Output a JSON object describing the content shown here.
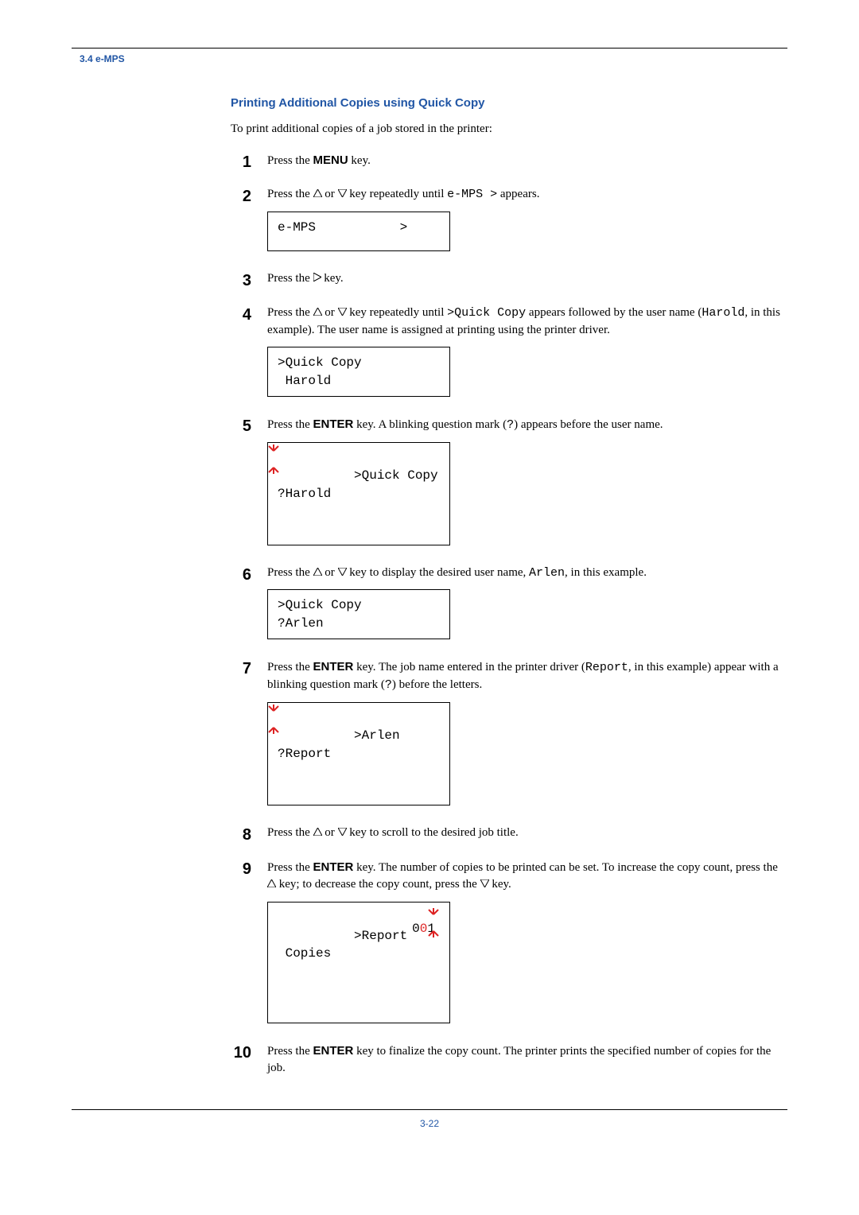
{
  "header": {
    "section": "3.4 e-MPS"
  },
  "title": "Printing Additional Copies using Quick Copy",
  "intro": "To print additional copies of a job stored in the printer:",
  "steps": {
    "s1": {
      "n": "1",
      "pre": "Press the ",
      "bold": "MENU",
      "post": " key."
    },
    "s2": {
      "n": "2",
      "a": "Press the  ",
      "b": " or ",
      "c": " key repeatedly until ",
      "mono": "e-MPS >",
      "d": " appears."
    },
    "s2d": "e-MPS           >\n",
    "s3": {
      "n": "3",
      "a": "Press the ",
      "b": " key."
    },
    "s4": {
      "n": "4",
      "a": "Press the ",
      "b": " or ",
      "c": " key repeatedly until ",
      "mono1": ">Quick Copy",
      "d": " appears followed by the user name (",
      "mono2": "Harold",
      "e": ", in this example). The user name is assigned at printing using the printer driver."
    },
    "s4d": ">Quick Copy\n Harold",
    "s5": {
      "n": "5",
      "a": "Press the ",
      "bold": "ENTER",
      "b": " key. A blinking question mark (",
      "mono": "?",
      "c": ") appears before the user name."
    },
    "s5d": ">Quick Copy\n?Harold",
    "s6": {
      "n": "6",
      "a": "Press the ",
      "b": " or ",
      "c": " key to display the desired user name, ",
      "mono": "Arlen",
      "d": ", in this example."
    },
    "s6d": ">Quick Copy\n?Arlen",
    "s7": {
      "n": "7",
      "a": "Press the ",
      "bold": "ENTER",
      "b": " key. The job name entered in the printer driver (",
      "mono1": "Report",
      "c": ", in this example) appear with a blinking question mark (",
      "mono2": "?",
      "d": ") before the letters."
    },
    "s7d": ">Arlen\n?Report",
    "s8": {
      "n": "8",
      "a": "Press the ",
      "b": " or ",
      "c": " key to scroll to the desired job title."
    },
    "s9": {
      "n": "9",
      "a": "Press the ",
      "bold": "ENTER",
      "b": " key. The number of copies to be printed can be set. To increase the copy count, press the ",
      "c": " key; to decrease the copy count, press the ",
      "d": " key."
    },
    "s9d": ">Report\n Copies       ",
    "s9n": "001",
    "s10": {
      "n": "10",
      "a": "Press the ",
      "bold": "ENTER",
      "b": " key to finalize the copy count. The printer prints the specified number of copies for the job."
    }
  },
  "footer": {
    "page": "3-22"
  }
}
